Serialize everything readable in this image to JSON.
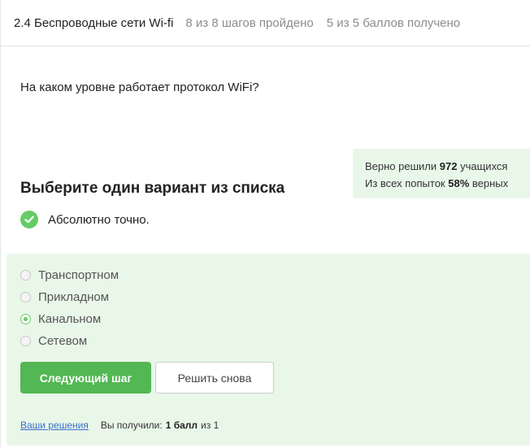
{
  "header": {
    "lesson_title": "2.4 Беспроводные сети Wi-fi",
    "steps_progress": "8 из 8 шагов пройдено",
    "points_progress": "5 из 5 баллов  получено"
  },
  "question": {
    "text": "На каком уровне работает протокол WiFi?"
  },
  "stats": {
    "solved_prefix": "Верно решили",
    "solved_count": "972",
    "solved_suffix": "учащихся",
    "attempts_prefix": "Из всех попыток",
    "attempts_percent": "58%",
    "attempts_suffix": "верных"
  },
  "instruction": "Выберите один вариант из списка",
  "feedback": {
    "text": "Абсолютно точно.",
    "icon": "check-circle-icon",
    "color": "#66cc66"
  },
  "options": [
    {
      "label": "Транспортном",
      "selected": false
    },
    {
      "label": "Прикладном",
      "selected": false
    },
    {
      "label": "Канальном",
      "selected": true
    },
    {
      "label": "Сетевом",
      "selected": false
    }
  ],
  "buttons": {
    "next_label": "Следующий шаг",
    "retry_label": "Решить снова"
  },
  "footer": {
    "solutions_link": "Ваши решения",
    "score_prefix": "Вы получили:",
    "score_value": "1 балл",
    "score_suffix": "из 1"
  },
  "colors": {
    "accent_green": "#53b753",
    "success_bg": "#e9f7e9",
    "link_blue": "#3a6fcb"
  }
}
